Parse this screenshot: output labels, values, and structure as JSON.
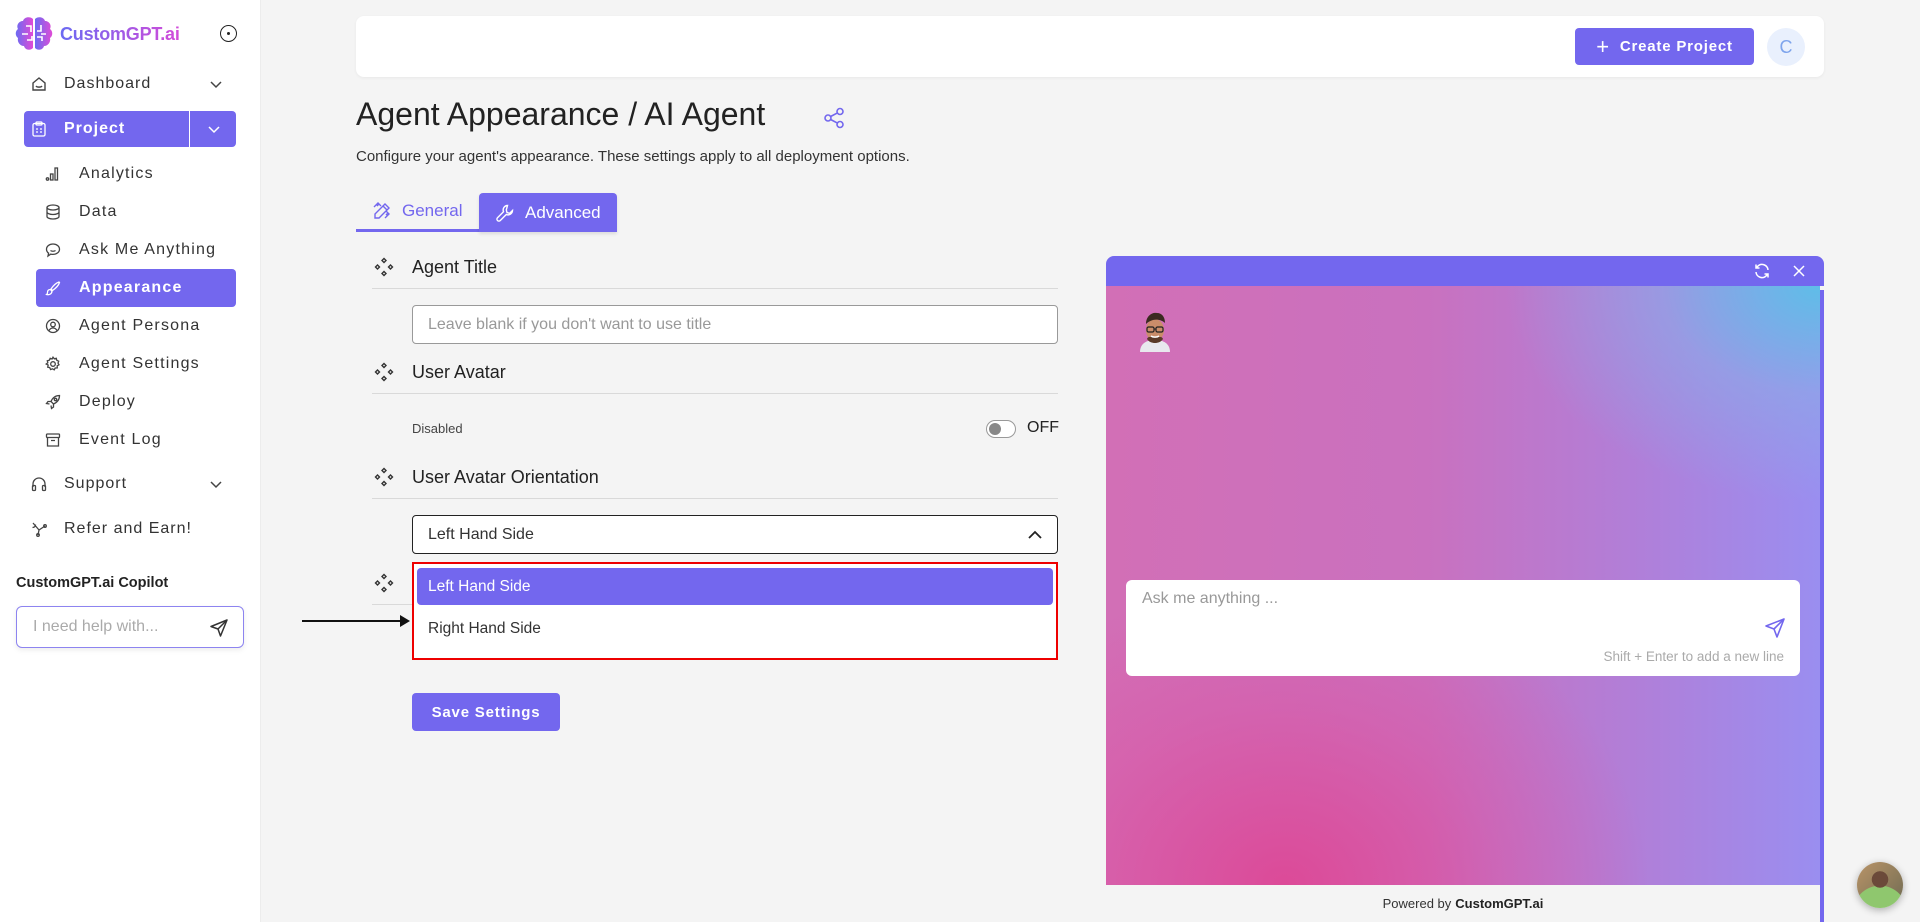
{
  "brand": {
    "name": "CustomGPT.ai",
    "accent": "#7367ee"
  },
  "sidebar": {
    "nav": [
      {
        "label": "Dashboard",
        "icon": "home-icon",
        "expandable": true
      },
      {
        "label": "Project",
        "icon": "clipboard-icon",
        "expandable": true,
        "active": true
      },
      {
        "label": "Support",
        "icon": "headset-icon",
        "expandable": true
      },
      {
        "label": "Refer and Earn!",
        "icon": "referral-icon",
        "expandable": false
      }
    ],
    "project_items": [
      {
        "label": "Analytics",
        "icon": "bar-chart-icon"
      },
      {
        "label": "Data",
        "icon": "database-icon"
      },
      {
        "label": "Ask Me Anything",
        "icon": "chat-icon"
      },
      {
        "label": "Appearance",
        "icon": "brush-icon",
        "active": true
      },
      {
        "label": "Agent Persona",
        "icon": "user-circle-icon"
      },
      {
        "label": "Agent Settings",
        "icon": "gear-icon"
      },
      {
        "label": "Deploy",
        "icon": "rocket-icon"
      },
      {
        "label": "Event Log",
        "icon": "archive-icon"
      }
    ],
    "copilot": {
      "label": "CustomGPT.ai Copilot",
      "placeholder": "I need help with..."
    }
  },
  "topbar": {
    "create_label": "Create Project",
    "user_initial": "C"
  },
  "page": {
    "title": "Agent Appearance / AI Agent",
    "subtitle": "Configure your agent's appearance. These settings apply to all deployment options."
  },
  "tabs": [
    {
      "label": "General",
      "icon": "pencil-ruler-icon",
      "active": false
    },
    {
      "label": "Advanced",
      "icon": "wrench-icon",
      "active": true
    }
  ],
  "sections": {
    "agent_title": {
      "title": "Agent Title",
      "placeholder": "Leave blank if you don't want to use title",
      "value": ""
    },
    "user_avatar": {
      "title": "User Avatar",
      "status_label": "Disabled",
      "toggle_label": "OFF",
      "enabled": false
    },
    "orientation": {
      "title": "User Avatar Orientation",
      "selected": "Left Hand Side",
      "options": [
        "Left Hand Side",
        "Right Hand Side"
      ],
      "highlighted_index": 0
    }
  },
  "save_label": "Save Settings",
  "preview": {
    "input_placeholder": "Ask me anything ...",
    "hint": "Shift + Enter to add a new line",
    "powered_prefix": "Powered by",
    "powered_brand": "CustomGPT.ai"
  }
}
